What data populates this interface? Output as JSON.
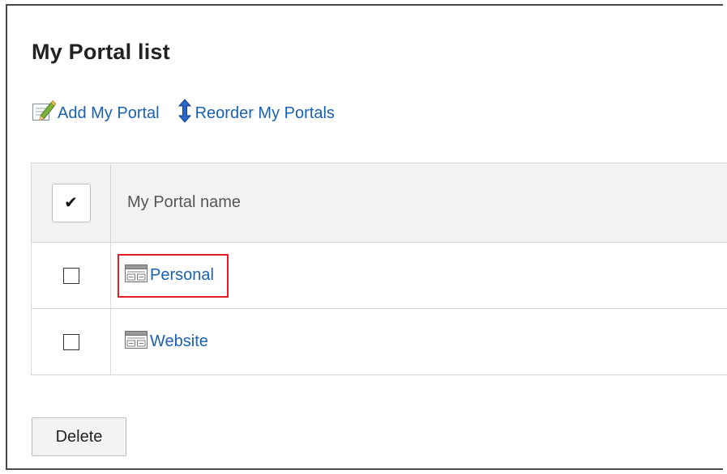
{
  "page": {
    "title": "My Portal list"
  },
  "toolbar": {
    "add_label": "Add My Portal",
    "reorder_label": "Reorder My Portals"
  },
  "table": {
    "check_all_symbol": "✔",
    "name_header": "My Portal name",
    "rows": [
      {
        "name": "Personal",
        "checked": false,
        "highlighted": true
      },
      {
        "name": "Website",
        "checked": false,
        "highlighted": false
      }
    ]
  },
  "actions": {
    "delete_label": "Delete"
  },
  "icons": {
    "add": "edit-pencil-icon",
    "reorder": "up-down-arrow-icon",
    "portal": "portal-layout-icon"
  },
  "colors": {
    "link": "#1a62b0",
    "highlight": "#e3202a",
    "header_bg": "#f2f2f2"
  }
}
